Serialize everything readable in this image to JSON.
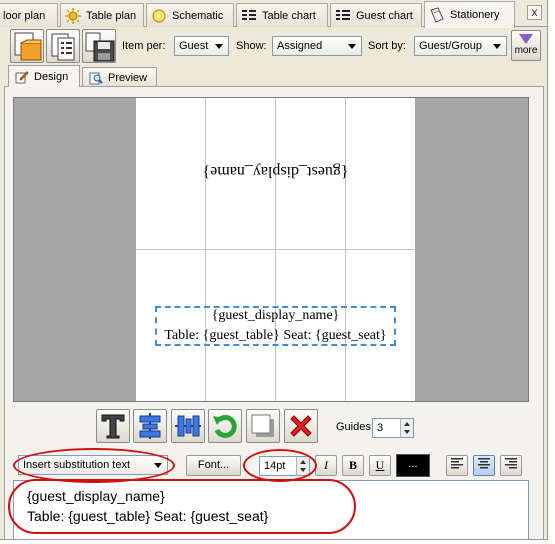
{
  "tabs": [
    {
      "label": "loor plan",
      "icon": "floor-plan-icon"
    },
    {
      "label": "Table plan",
      "icon": "table-plan-icon"
    },
    {
      "label": "Schematic",
      "icon": "schematic-icon"
    },
    {
      "label": "Table chart",
      "icon": "table-chart-icon"
    },
    {
      "label": "Guest chart",
      "icon": "guest-chart-icon"
    },
    {
      "label": "Stationery",
      "icon": "stationery-icon",
      "active": true
    }
  ],
  "close_label": "x",
  "toolbar": {
    "item_per_label": "Item per:",
    "item_per_value": "Guest",
    "show_label": "Show:",
    "show_value": "Assigned",
    "sort_by_label": "Sort by:",
    "sort_by_value": "Guest/Group",
    "more_label": "more"
  },
  "subtabs": {
    "design": "Design",
    "preview": "Preview"
  },
  "card": {
    "flipped_text": "{guest_display_name}",
    "line1": "{guest_display_name}",
    "line2": "Table: {guest_table} Seat: {guest_seat}"
  },
  "bottom": {
    "guides_label": "Guides:",
    "guides_value": "3",
    "insert_substitution": "Insert substitution text",
    "font_button": "Font...",
    "font_size": "14pt",
    "italic": "I",
    "bold": "B",
    "underline": "U",
    "color_button": "..."
  },
  "editor": {
    "line1": "{guest_display_name}",
    "line2": "Table: {guest_table} Seat: {guest_seat}"
  },
  "colors": {
    "annotation_red": "#d01010",
    "selection_blue": "#3a8fe0",
    "delete_red": "#e02020",
    "rotate_green": "#2aa33a"
  }
}
